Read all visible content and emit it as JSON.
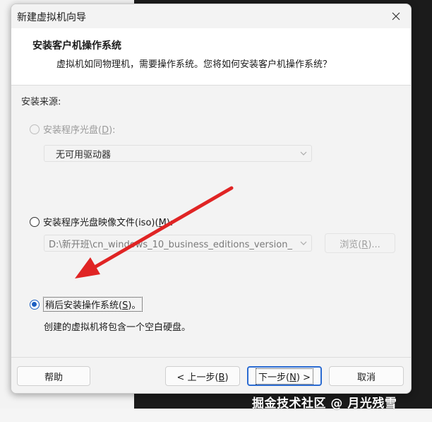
{
  "window": {
    "title": "新建虚拟机向导"
  },
  "header": {
    "title": "安装客户机操作系统",
    "subtitle": "虚拟机如同物理机，需要操作系统。您将如何安装客户机操作系统？"
  },
  "source": {
    "section_label": "安装来源:",
    "disc_option": {
      "label_pre": "安装程序光盘(",
      "hotkey": "D",
      "label_post": "):",
      "selected": false,
      "enabled": false
    },
    "disc_drive": {
      "value": "无可用驱动器"
    },
    "iso_option": {
      "label_pre": "安装程序光盘映像文件(iso)(",
      "hotkey": "M",
      "label_post": "):",
      "selected": false,
      "enabled": true
    },
    "iso_path": {
      "value": "D:\\新开班\\cn_windows_10_business_editions_version_"
    },
    "browse": {
      "label_pre": "浏览(",
      "hotkey": "R",
      "label_post": ")..."
    },
    "later_option": {
      "label_pre": "稍后安装操作系统(",
      "hotkey": "S",
      "label_post": ")。",
      "selected": true,
      "enabled": true
    },
    "later_description": "创建的虚拟机将包含一个空白硬盘。"
  },
  "footer": {
    "help": "帮助",
    "back": {
      "label_pre": "< 上一步(",
      "hotkey": "B",
      "label_post": ")"
    },
    "next": {
      "label_pre": "下一步(",
      "hotkey": "N",
      "label_post": ") >"
    },
    "cancel": "取消"
  },
  "watermark": "掘金技术社区 @ 月光残雪",
  "colors": {
    "accent": "#1d5fc2",
    "annotation_arrow": "#e02424",
    "backdrop": "#1b1b1b"
  },
  "icons": {
    "close": "close-icon",
    "dropdown": "chevron-down-icon",
    "annotation": "red-arrow-annotation"
  }
}
